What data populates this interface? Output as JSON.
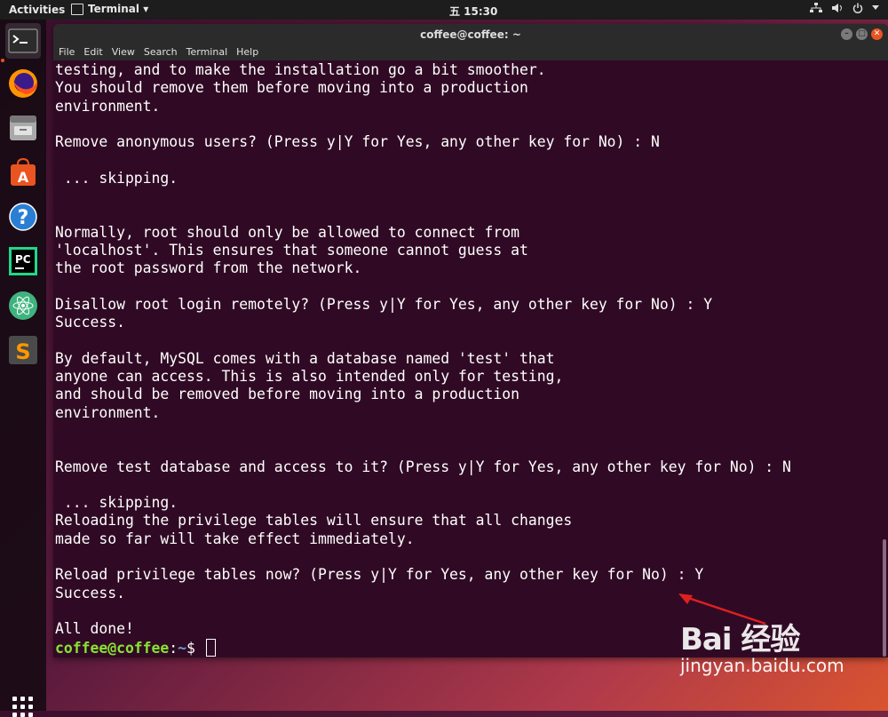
{
  "topbar": {
    "activities": "Activities",
    "app_menu": "Terminal ▾",
    "clock": "五 15:30"
  },
  "dock": {
    "items": [
      "terminal-icon",
      "firefox-icon",
      "files-icon",
      "software-center-icon",
      "help-icon",
      "pycharm-icon",
      "atom-icon",
      "sublime-icon"
    ],
    "pycharm_label": "PC",
    "software_label": "A",
    "help_label": "?",
    "sublime_label": "S"
  },
  "window": {
    "title": "coffee@coffee: ~",
    "menu": [
      "File",
      "Edit",
      "View",
      "Search",
      "Terminal",
      "Help"
    ]
  },
  "terminal": {
    "lines": [
      "testing, and to make the installation go a bit smoother.",
      "You should remove them before moving into a production",
      "environment.",
      "",
      "Remove anonymous users? (Press y|Y for Yes, any other key for No) : N",
      "",
      " ... skipping.",
      "",
      "",
      "Normally, root should only be allowed to connect from",
      "'localhost'. This ensures that someone cannot guess at",
      "the root password from the network.",
      "",
      "Disallow root login remotely? (Press y|Y for Yes, any other key for No) : Y",
      "Success.",
      "",
      "By default, MySQL comes with a database named 'test' that",
      "anyone can access. This is also intended only for testing,",
      "and should be removed before moving into a production",
      "environment.",
      "",
      "",
      "Remove test database and access to it? (Press y|Y for Yes, any other key for No) : N",
      "",
      " ... skipping.",
      "Reloading the privilege tables will ensure that all changes",
      "made so far will take effect immediately.",
      "",
      "Reload privilege tables now? (Press y|Y for Yes, any other key for No) : Y",
      "Success.",
      "",
      "All done!"
    ],
    "prompt_user": "coffee@coffee",
    "prompt_sep": ":",
    "prompt_path": "~",
    "prompt_symbol": "$ "
  },
  "watermark": {
    "logo": "Bai 经验",
    "url": "jingyan.baidu.com"
  },
  "colors": {
    "terminal_bg": "#300a24",
    "prompt_user": "#8ae234",
    "prompt_path": "#729fcf",
    "accent": "#e95420",
    "arrow": "#e0201f"
  }
}
